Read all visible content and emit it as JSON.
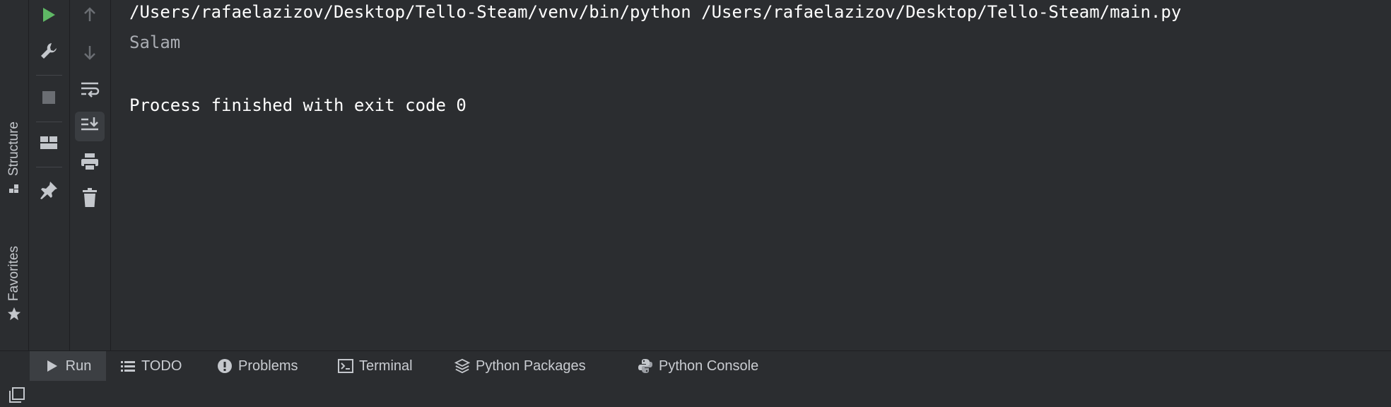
{
  "side_tabs": {
    "structure": {
      "label": "Structure",
      "icon": "structure-icon"
    },
    "favorites": {
      "label": "Favorites",
      "icon": "star-icon"
    }
  },
  "run_toolbar": {
    "column1": [
      "play-icon",
      "wrench-icon",
      "stop-icon",
      "layout-icon",
      "pin-icon"
    ],
    "column2": [
      "arrow-up-icon",
      "arrow-down-icon",
      "soft-wrap-icon",
      "scroll-to-end-icon",
      "print-icon",
      "trash-icon"
    ]
  },
  "console": {
    "command": "/Users/rafaelazizov/Desktop/Tello-Steam/venv/bin/python /Users/rafaelazizov/Desktop/Tello-Steam/main.py",
    "output": "Salam",
    "exit_message": "Process finished with exit code 0"
  },
  "bottom_tabs": [
    {
      "label": "Run",
      "icon": "play-icon",
      "active": true
    },
    {
      "label": "TODO",
      "icon": "list-icon",
      "active": false
    },
    {
      "label": "Problems",
      "icon": "warning-icon",
      "active": false
    },
    {
      "label": "Terminal",
      "icon": "terminal-icon",
      "active": false
    },
    {
      "label": "Python Packages",
      "icon": "layers-icon",
      "active": false
    },
    {
      "label": "Python Console",
      "icon": "python-icon",
      "active": false
    }
  ],
  "status_bar": {
    "icon": "window-icon"
  },
  "colors": {
    "background": "#2b2d30",
    "run_green": "#5fb865",
    "icon_gray": "#8c8f94",
    "text_white": "#ffffff",
    "text_gray": "#a9acb2"
  }
}
